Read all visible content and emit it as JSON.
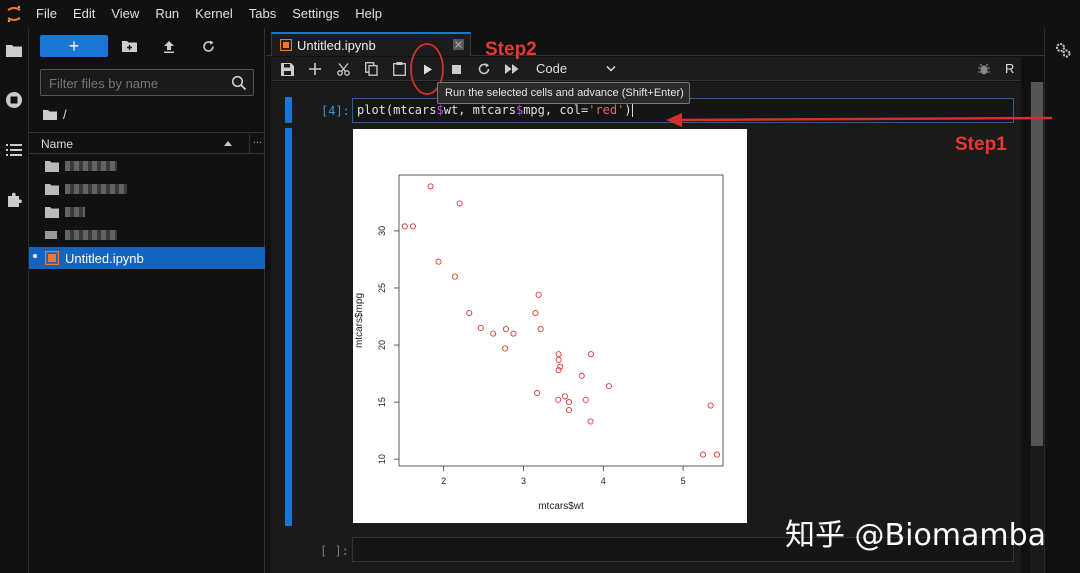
{
  "menubar": {
    "items": [
      "File",
      "Edit",
      "View",
      "Run",
      "Kernel",
      "Tabs",
      "Settings",
      "Help"
    ]
  },
  "filebrowser": {
    "new_label": "+",
    "filter_placeholder": "Filter files by name",
    "breadcrumb": "/",
    "header_name": "Name",
    "header_more": "...",
    "selected_file": "Untitled.ipynb"
  },
  "tab": {
    "title": "Untitled.ipynb"
  },
  "toolbar": {
    "cell_type": "Code",
    "kernel": "R"
  },
  "tooltip": "Run the selected cells and advance (Shift+Enter)",
  "cells": [
    {
      "prompt": "[4]:",
      "code_parts": [
        "plot(mtcars",
        "$",
        "wt, mtcars",
        "$",
        "mpg, col=",
        "'red'",
        ")"
      ]
    },
    {
      "prompt": "[ ]:"
    }
  ],
  "annotations": {
    "step1": "Step1",
    "step2": "Step2"
  },
  "watermark": "知乎 @Biomamba",
  "colors": {
    "accent": "#1976d2",
    "annotation": "#e53935",
    "points": "#e53935"
  },
  "chart_data": {
    "type": "scatter",
    "xlabel": "mtcars$wt",
    "ylabel": "mtcars$mpg",
    "xticks": [
      2,
      3,
      4,
      5
    ],
    "yticks": [
      10,
      15,
      20,
      25,
      30
    ],
    "xlim": [
      1.44,
      5.5
    ],
    "ylim": [
      9.4,
      34.9
    ],
    "marker": "open-circle",
    "x": [
      2.62,
      2.875,
      2.32,
      3.215,
      3.44,
      3.46,
      3.57,
      3.19,
      3.15,
      3.44,
      3.44,
      4.07,
      3.73,
      3.78,
      5.25,
      5.424,
      5.345,
      2.2,
      1.615,
      1.835,
      2.465,
      3.52,
      3.435,
      3.84,
      3.845,
      1.935,
      2.14,
      1.513,
      3.17,
      2.77,
      3.57,
      2.78
    ],
    "y": [
      21.0,
      21.0,
      22.8,
      21.4,
      18.7,
      18.1,
      14.3,
      24.4,
      22.8,
      19.2,
      17.8,
      16.4,
      17.3,
      15.2,
      10.4,
      10.4,
      14.7,
      32.4,
      30.4,
      33.9,
      21.5,
      15.5,
      15.2,
      13.3,
      19.2,
      27.3,
      26.0,
      30.4,
      15.8,
      19.7,
      15.0,
      21.4
    ]
  }
}
